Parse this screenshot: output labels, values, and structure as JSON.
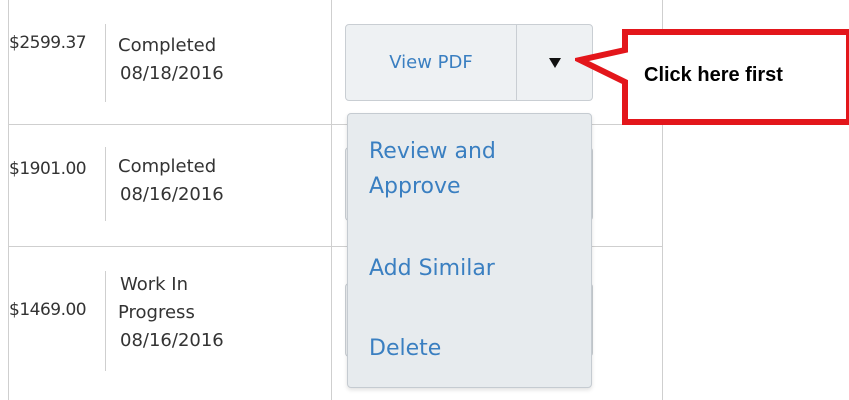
{
  "rows": [
    {
      "amount": "$2599.37",
      "status": [
        "Completed",
        "08/18/2016"
      ]
    },
    {
      "amount": "$1901.00",
      "status": [
        "Completed",
        "08/16/2016"
      ]
    },
    {
      "amount": "$1469.00",
      "status": [
        "Work In",
        "Progress",
        "08/16/2016"
      ]
    }
  ],
  "action": {
    "main_label": "View PDF",
    "caret_icon": "caret-down-icon"
  },
  "menu": {
    "items": [
      "Review and Approve",
      "Add Similar",
      "Delete"
    ],
    "item1_lines": [
      "Review and",
      "Approve"
    ]
  },
  "callout": {
    "text": "Click here first",
    "border_color": "#e3161b"
  },
  "colors": {
    "link": "#3a7fc1",
    "button_bg": "#eef1f3",
    "menu_bg": "#e7ebee"
  }
}
